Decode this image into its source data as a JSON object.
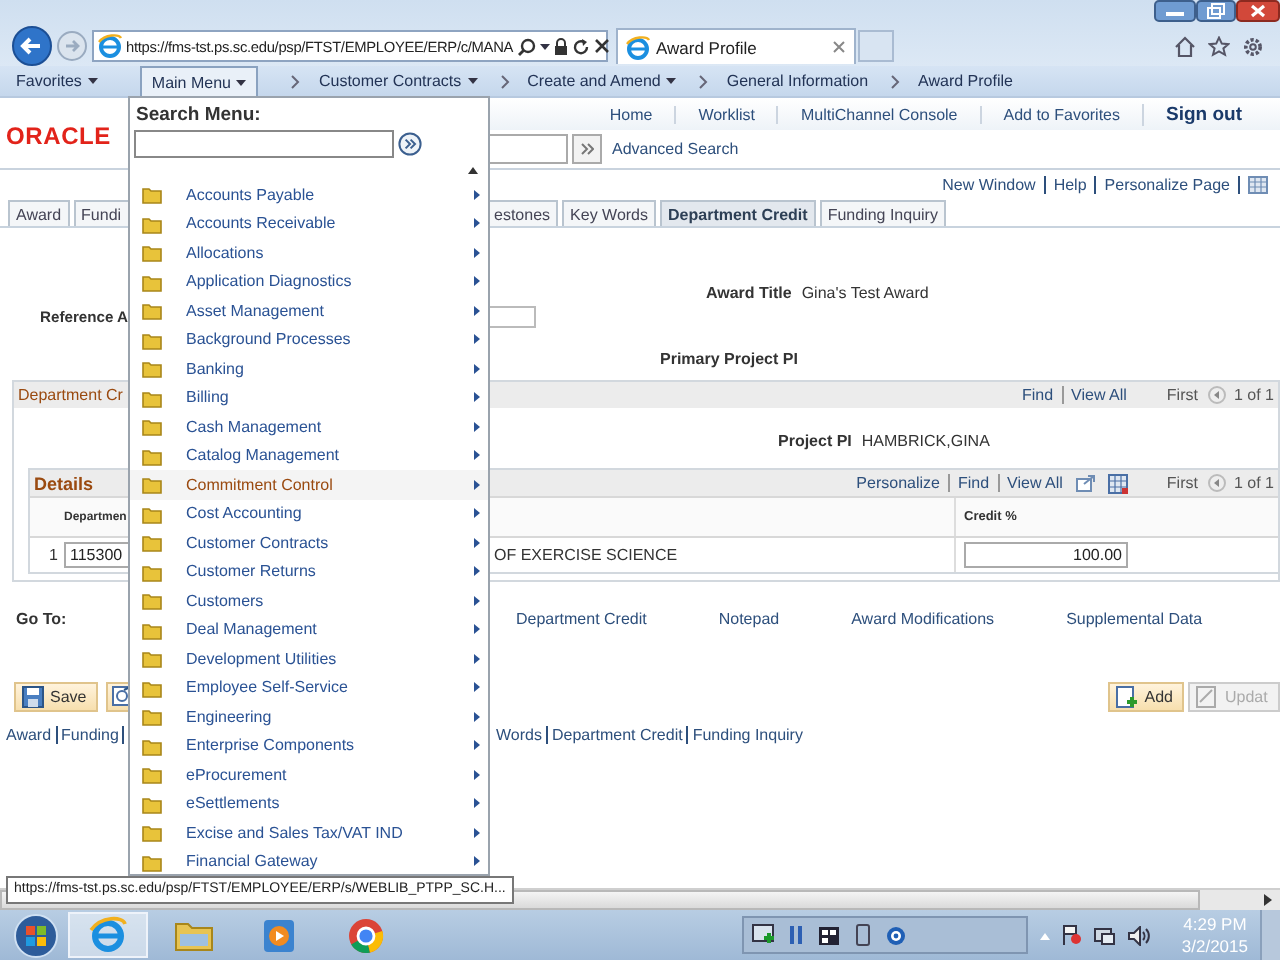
{
  "browser": {
    "address": "https://fms-tst.ps.sc.edu/psp/FTST/EMPLOYEE/ERP/c/MANA",
    "tabs": [
      {
        "title": "Award Profile",
        "selected": true
      }
    ]
  },
  "nav_bar": [
    {
      "label": "Favorites",
      "kind": "menu",
      "dropdown": true,
      "selected": false
    },
    {
      "label": "Main Menu",
      "kind": "menu",
      "dropdown": true,
      "selected": true
    },
    {
      "label": "Customer Contracts",
      "kind": "crumb",
      "dropdown": true,
      "selected": false
    },
    {
      "label": "Create and Amend",
      "kind": "crumb",
      "dropdown": true,
      "selected": false
    },
    {
      "label": "General Information",
      "kind": "crumb",
      "dropdown": false,
      "selected": false
    },
    {
      "label": "Award Profile",
      "kind": "crumb",
      "dropdown": false,
      "selected": false
    }
  ],
  "header": {
    "logo": "ORACLE",
    "links": [
      {
        "label": "Home",
        "kind": "link"
      },
      {
        "label": "Worklist",
        "kind": "link"
      },
      {
        "label": "MultiChannel Console",
        "kind": "link"
      },
      {
        "label": "Add to Favorites",
        "kind": "link"
      },
      {
        "label": "Sign out",
        "kind": "signout"
      }
    ],
    "advanced_search": "Advanced Search"
  },
  "page_links": [
    "New Window",
    "Help",
    "Personalize Page"
  ],
  "page_tabs": [
    {
      "label": "Award",
      "selected": false
    },
    {
      "label": "Fundi",
      "selected": false
    },
    {
      "label": "estones",
      "selected": false
    },
    {
      "label": "Key Words",
      "selected": false
    },
    {
      "label": "Department Credit",
      "selected": true
    },
    {
      "label": "Funding Inquiry",
      "selected": false
    }
  ],
  "award_title": {
    "label": "Award Title",
    "value": "Gina's Test Award"
  },
  "reference": {
    "label": "Reference A"
  },
  "primary_pi": {
    "label": "Primary Project PI"
  },
  "department_credit": {
    "title": "Department Cr",
    "nav": [
      "Find",
      "View All"
    ],
    "first": "First",
    "count": "1 of 1",
    "project_pi": {
      "label": "Project PI",
      "value": "HAMBRICK,GINA"
    },
    "details": {
      "title": "Details",
      "nav": [
        "Personalize",
        "Find",
        "View All"
      ],
      "first": "First",
      "count": "1 of 1",
      "columns": [
        "Departmen",
        "Credit %"
      ],
      "rows": [
        {
          "number": "1",
          "department": "115300",
          "description": "OF EXERCISE SCIENCE",
          "credit": "100.00"
        }
      ]
    }
  },
  "go_to": {
    "label": "Go To:",
    "links": [
      "Department Credit",
      "Notepad",
      "Award Modifications",
      "Supplemental Data"
    ]
  },
  "buttons": [
    {
      "label": "Save",
      "kind": "save",
      "disabled": false
    },
    {
      "label": "Add",
      "kind": "add",
      "disabled": false
    },
    {
      "label": "Updat",
      "kind": "update",
      "disabled": true
    }
  ],
  "bottom_links": {
    "left": [
      "Award",
      "Funding"
    ],
    "right": [
      "Words",
      "Department Credit",
      "Funding Inquiry"
    ]
  },
  "search_menu": {
    "title": "Search Menu:",
    "items": [
      {
        "label": "Accounts Payable",
        "selected": false
      },
      {
        "label": "Accounts Receivable",
        "selected": false
      },
      {
        "label": "Allocations",
        "selected": false
      },
      {
        "label": "Application Diagnostics",
        "selected": false
      },
      {
        "label": "Asset Management",
        "selected": false
      },
      {
        "label": "Background Processes",
        "selected": false
      },
      {
        "label": "Banking",
        "selected": false
      },
      {
        "label": "Billing",
        "selected": false
      },
      {
        "label": "Cash Management",
        "selected": false
      },
      {
        "label": "Catalog Management",
        "selected": false
      },
      {
        "label": "Commitment Control",
        "selected": true
      },
      {
        "label": "Cost Accounting",
        "selected": false
      },
      {
        "label": "Customer Contracts",
        "selected": false
      },
      {
        "label": "Customer Returns",
        "selected": false
      },
      {
        "label": "Customers",
        "selected": false
      },
      {
        "label": "Deal Management",
        "selected": false
      },
      {
        "label": "Development Utilities",
        "selected": false
      },
      {
        "label": "Employee Self-Service",
        "selected": false
      },
      {
        "label": "Engineering",
        "selected": false
      },
      {
        "label": "Enterprise Components",
        "selected": false
      },
      {
        "label": "eProcurement",
        "selected": false
      },
      {
        "label": "eSettlements",
        "selected": false
      },
      {
        "label": "Excise and Sales Tax/VAT IND",
        "selected": false
      },
      {
        "label": "Financial Gateway",
        "selected": false
      }
    ]
  },
  "status_tooltip": "https://fms-tst.ps.sc.edu/psp/FTST/EMPLOYEE/ERP/s/WEBLIB_PTPP_SC.H...",
  "taskbar": {
    "apps": [
      {
        "kind": "ie",
        "selected": true
      },
      {
        "kind": "folder",
        "selected": false
      },
      {
        "kind": "media",
        "selected": false
      },
      {
        "kind": "chrome",
        "selected": false
      }
    ],
    "time": "4:29 PM",
    "date": "3/2/2015"
  }
}
